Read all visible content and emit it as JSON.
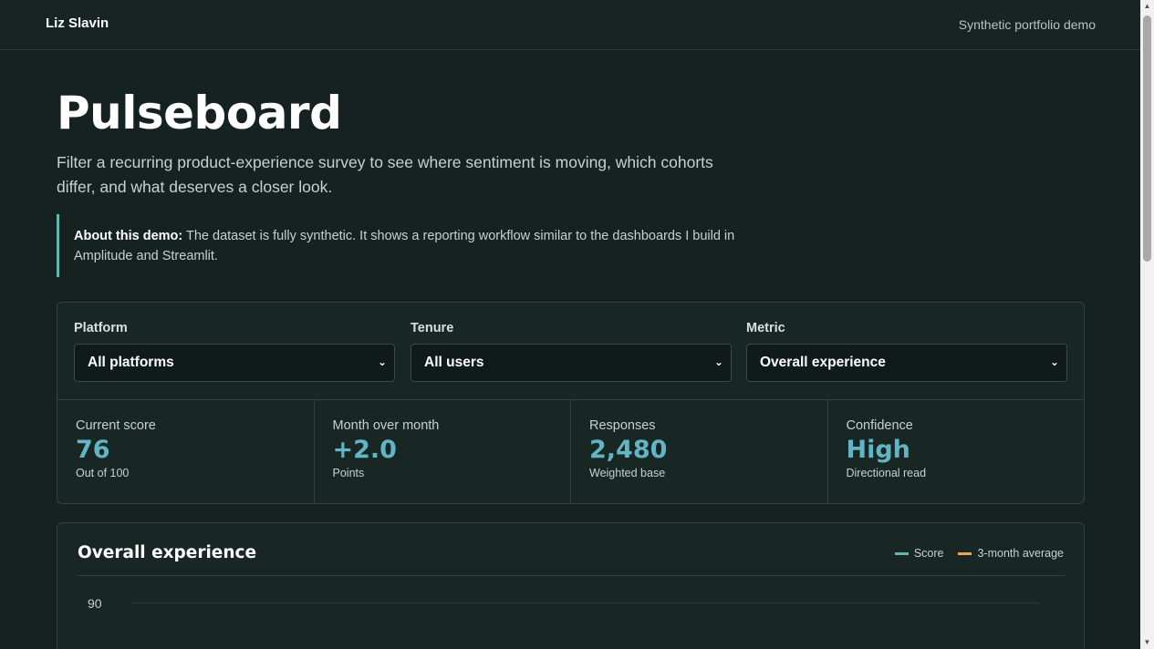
{
  "header": {
    "brand": "Liz Slavin",
    "note": "Synthetic portfolio demo"
  },
  "hero": {
    "title": "Pulseboard",
    "intro": "Filter a recurring product-experience survey to see where sentiment is moving, which cohorts differ, and what deserves a closer look."
  },
  "notice": {
    "label": "About this demo:",
    "text": " The dataset is fully synthetic. It shows a reporting workflow similar to the dashboards I build in Amplitude and Streamlit."
  },
  "filters": [
    {
      "label": "Platform",
      "value": "All platforms"
    },
    {
      "label": "Tenure",
      "value": "All users"
    },
    {
      "label": "Metric",
      "value": "Overall experience"
    }
  ],
  "kpis": [
    {
      "label": "Current score",
      "value": "76",
      "sub": "Out of 100"
    },
    {
      "label": "Month over month",
      "value": "+2.0",
      "sub": "Points"
    },
    {
      "label": "Responses",
      "value": "2,480",
      "sub": "Weighted base"
    },
    {
      "label": "Confidence",
      "value": "High",
      "sub": "Directional read"
    }
  ],
  "chart": {
    "title": "Overall experience",
    "legend": [
      {
        "name": "Score",
        "color": "#5fb9b3"
      },
      {
        "name": "3-month average",
        "color": "#e9a55a"
      }
    ],
    "ticks": [
      "90"
    ]
  },
  "colors": {
    "accent": "#62b5c4",
    "border_accent": "#5fb9b3"
  },
  "icons": {
    "select_chevron": "chevron-down-icon"
  }
}
